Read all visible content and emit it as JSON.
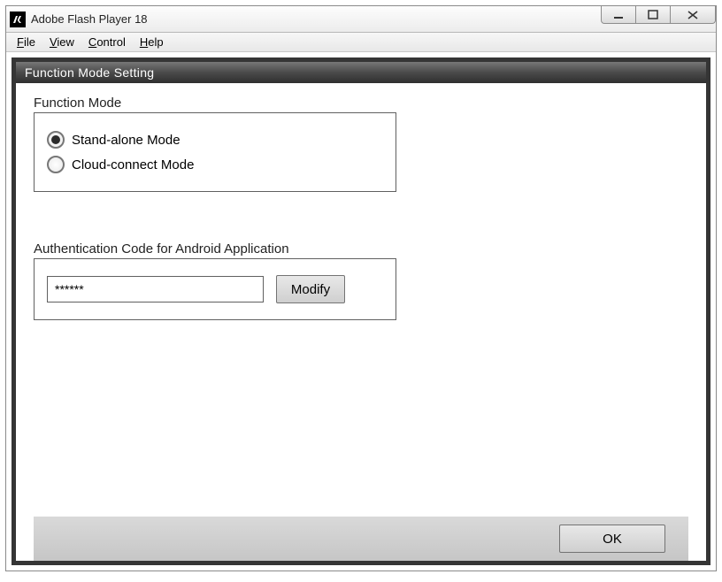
{
  "window": {
    "title": "Adobe Flash Player 18"
  },
  "menu": {
    "file": "File",
    "view": "View",
    "control": "Control",
    "help": "Help"
  },
  "panel": {
    "title": "Function Mode Setting"
  },
  "function_mode": {
    "label": "Function Mode",
    "options": {
      "standalone": "Stand-alone Mode",
      "cloud": "Cloud-connect Mode"
    },
    "selected": "standalone"
  },
  "auth": {
    "label": "Authentication Code for Android Application",
    "value": "******",
    "modify_label": "Modify"
  },
  "footer": {
    "ok_label": "OK"
  }
}
